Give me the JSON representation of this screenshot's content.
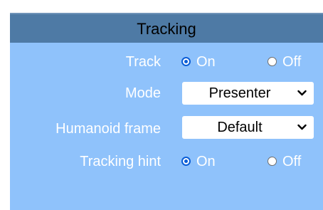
{
  "panel": {
    "title": "Tracking"
  },
  "track": {
    "label": "Track",
    "options": [
      {
        "label": "On",
        "checked": true
      },
      {
        "label": "Off",
        "checked": false
      }
    ]
  },
  "mode": {
    "label": "Mode",
    "selected": "Presenter"
  },
  "humanoid_frame": {
    "label": "Humanoid frame",
    "selected": "Default"
  },
  "tracking_hint": {
    "label": "Tracking hint",
    "options": [
      {
        "label": "On",
        "checked": true
      },
      {
        "label": "Off",
        "checked": false
      }
    ]
  },
  "colors": {
    "panel_background": "#8fc2fb",
    "header_background": "#4e7aa5",
    "radio_accent": "#0b5ed7"
  },
  "icons": {
    "select_arrow": "chevron-down-icon"
  }
}
